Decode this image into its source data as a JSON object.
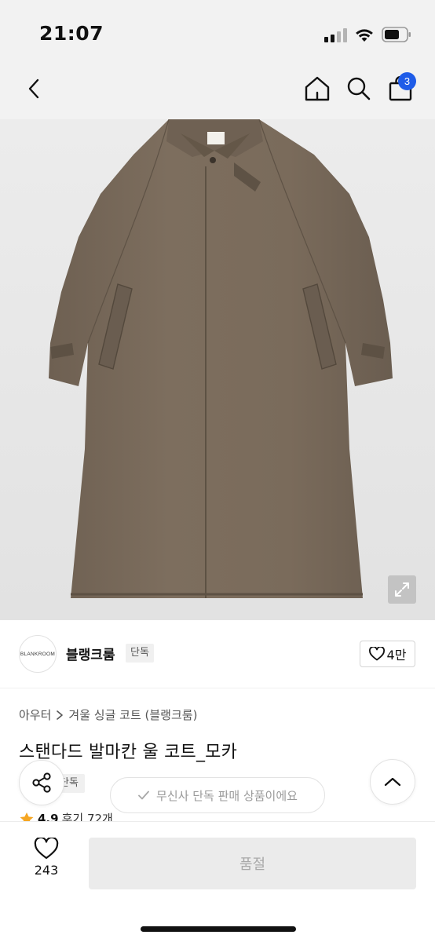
{
  "status_bar": {
    "time": "21:07"
  },
  "header": {
    "cart_count": "3"
  },
  "icons": {
    "back": "chevron-left-icon",
    "home": "home-icon",
    "search": "search-icon",
    "cart": "shopping-bag-icon",
    "expand": "expand-icon",
    "heart": "heart-icon",
    "share": "share-icon",
    "scroll_top": "chevron-up-icon",
    "check": "check-icon",
    "star": "star-icon"
  },
  "brand": {
    "logo_text": "BLANKROOM",
    "name": "블랭크룸",
    "exclusive_tag": "단독",
    "like_count": "4만"
  },
  "breadcrumb": {
    "category": "아우터",
    "subcategory": "겨울 싱글 코트 (블랭크룸)"
  },
  "product": {
    "title": "스탠다드 발마칸 울 코트_모카",
    "exclusive_tag": "단독",
    "rating": "4.9",
    "reviews": "후기 72개"
  },
  "toast": {
    "text": "무신사 단독 판매 상품이에요"
  },
  "bottom_bar": {
    "wish_count": "243",
    "soldout_label": "품절"
  },
  "colors": {
    "accent": "#1f5ce8",
    "coat": "#7a6b5c",
    "star": "#f5a623"
  }
}
